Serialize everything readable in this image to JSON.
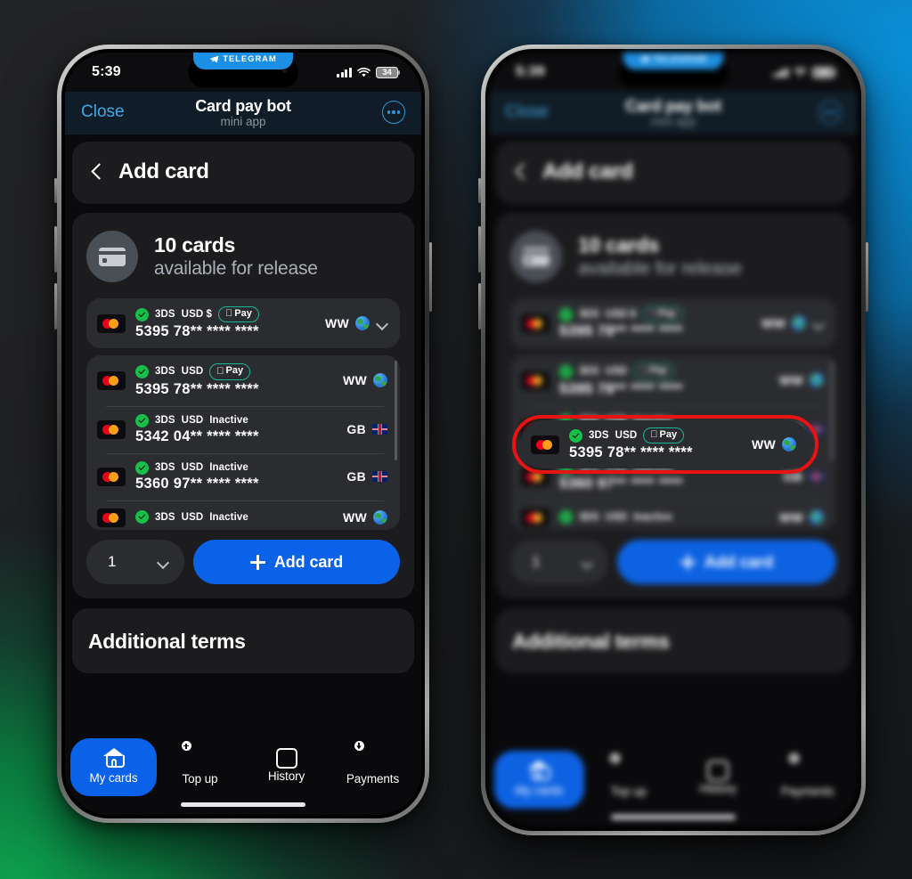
{
  "background": {
    "accent_blue": "#0a8fd6",
    "accent_green": "#0e9f4e",
    "base": "#1e1f21"
  },
  "status_bar": {
    "time": "5:39",
    "battery_level": "34",
    "telegram_pill_label": "TELEGRAM",
    "signal_icon": "signal-bars-icon",
    "wifi_icon": "wifi-icon",
    "battery_icon": "battery-icon"
  },
  "telegram_header": {
    "close_label": "Close",
    "title": "Card pay bot",
    "subtitle": "mini app",
    "menu_icon": "more-options-icon",
    "background": "#101d28",
    "link_color": "#3fa9e8"
  },
  "page": {
    "back_icon": "chevron-left-icon",
    "title": "Add card"
  },
  "cards_summary": {
    "icon": "credit-card-icon",
    "count_label": "10 cards",
    "availability_label": "available for release"
  },
  "cards": [
    {
      "brand_icon": "mastercard-icon",
      "verified_icon": "check-circle-icon",
      "badge_3ds": "3DS",
      "badge_currency": "USD $",
      "apple_pay": "Pay",
      "apple_icon": "apple-logo-icon",
      "status": "",
      "number": "5395 78** **** ****",
      "region_code": "WW",
      "region_icon": "globe-icon",
      "expand_icon": "chevron-down-icon",
      "selected": true
    },
    {
      "brand_icon": "mastercard-icon",
      "verified_icon": "check-circle-icon",
      "badge_3ds": "3DS",
      "badge_currency": "USD",
      "apple_pay": "Pay",
      "apple_icon": "apple-logo-icon",
      "status": "",
      "number": "5395 78** **** ****",
      "region_code": "WW",
      "region_icon": "globe-icon",
      "selected": false
    },
    {
      "brand_icon": "mastercard-icon",
      "verified_icon": "check-circle-icon",
      "badge_3ds": "3DS",
      "badge_currency": "USD",
      "apple_pay": "",
      "status": "Inactive",
      "number": "5342 04** **** ****",
      "region_code": "GB",
      "region_icon": "flag-gb-icon",
      "selected": false
    },
    {
      "brand_icon": "mastercard-icon",
      "verified_icon": "check-circle-icon",
      "badge_3ds": "3DS",
      "badge_currency": "USD",
      "apple_pay": "",
      "status": "Inactive",
      "number": "5360 97** **** ****",
      "region_code": "GB",
      "region_icon": "flag-gb-icon",
      "selected": false
    },
    {
      "brand_icon": "mastercard-icon",
      "verified_icon": "check-circle-icon",
      "badge_3ds": "3DS",
      "badge_currency": "USD",
      "apple_pay": "",
      "status": "Inactive",
      "number": "",
      "region_code": "WW",
      "region_icon": "globe-icon",
      "selected": false
    }
  ],
  "actions": {
    "quantity_value": "1",
    "quantity_chevron_icon": "chevron-down-icon",
    "add_card_label": "Add card",
    "add_card_icon": "plus-icon",
    "add_card_color": "#0a62e8"
  },
  "terms": {
    "title": "Additional terms"
  },
  "tabbar": {
    "items": [
      {
        "label": "My cards",
        "icon": "home-icon",
        "active": true
      },
      {
        "label": "Top up",
        "icon": "card-plus-icon",
        "active": false
      },
      {
        "label": "History",
        "icon": "book-icon",
        "active": false
      },
      {
        "label": "Payments",
        "icon": "card-download-icon",
        "active": false
      }
    ],
    "active_color": "#0a62e8"
  },
  "annotation": {
    "highlight_color": "#e81414",
    "highlighted_card_index": 1
  }
}
